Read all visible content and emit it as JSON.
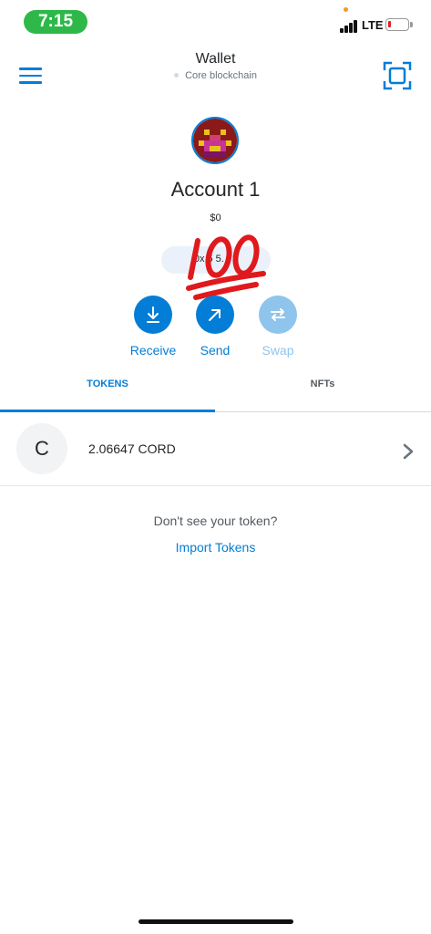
{
  "status_bar": {
    "time": "7:15",
    "carrier": "LTE"
  },
  "header": {
    "title": "Wallet",
    "network": "Core blockchain",
    "menu_icon": "hamburger-menu-icon",
    "scan_icon": "qr-scan-icon"
  },
  "account": {
    "name": "Account 1",
    "balance": "$0",
    "address": "0x 5 5. 78",
    "overlay_emoji": "💯"
  },
  "actions": [
    {
      "label": "Receive",
      "icon": "download-arrow-icon",
      "enabled": true
    },
    {
      "label": "Send",
      "icon": "arrow-up-right-icon",
      "enabled": true
    },
    {
      "label": "Swap",
      "icon": "swap-arrows-icon",
      "enabled": false
    }
  ],
  "tabs": [
    {
      "label": "TOKENS",
      "active": true
    },
    {
      "label": "NFTs",
      "active": false
    }
  ],
  "tokens": [
    {
      "symbol_letter": "C",
      "amount": "2.06647 CORD"
    }
  ],
  "empty_prompt": {
    "question": "Don't see your token?",
    "link": "Import Tokens"
  },
  "colors": {
    "accent": "#037dd6",
    "accent_disabled": "#8fc4ec",
    "status_green": "#2fb84a"
  }
}
